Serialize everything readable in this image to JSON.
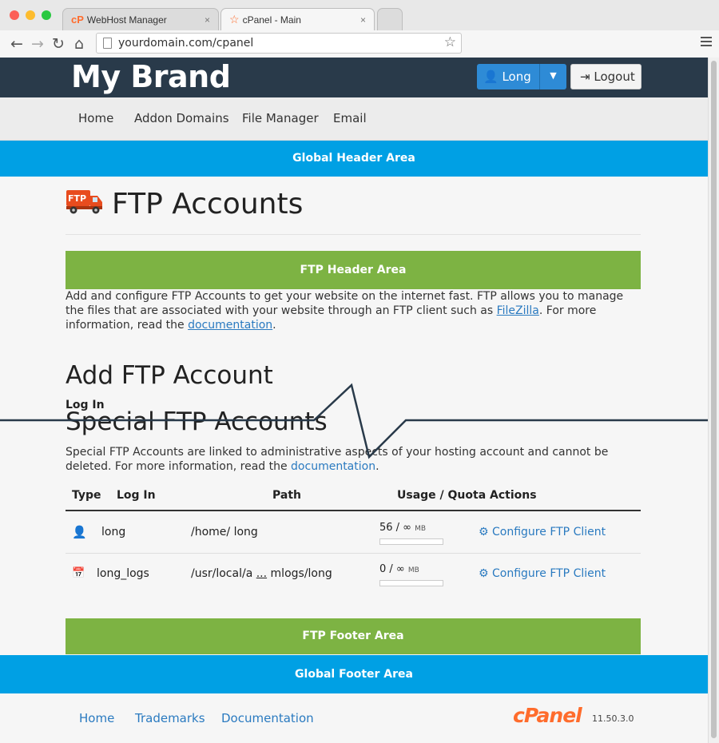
{
  "browser": {
    "tabs": [
      {
        "label": "WebHost Manager",
        "close": "×"
      },
      {
        "label": "cPanel - Main",
        "close": "×"
      }
    ],
    "url": "yourdomain.com/cpanel"
  },
  "header": {
    "brand": "My Brand",
    "user_label": "Long",
    "logout_label": "Logout"
  },
  "nav": [
    "Home",
    "Addon Domains",
    "File Manager",
    "Email"
  ],
  "global_header": "Global Header Area",
  "page_title": "FTP Accounts",
  "ftp_icon_text": "FTP",
  "ftp_header": "FTP Header Area",
  "intro": {
    "text1": "Add and configure FTP Accounts to get your website on the internet fast. FTP allows you to manage the files that are associated with your website through an FTP client such as ",
    "link1": "FileZilla",
    "text2": ". For more information, read the ",
    "link2": "documentation",
    "text3": "."
  },
  "add_title": "Add FTP Account",
  "login_label": "Log In",
  "special_title": "Special FTP Accounts",
  "special_desc": {
    "text1": "Special FTP Accounts are linked to administrative aspects of your hosting account and cannot be deleted. For more information, read the ",
    "link": "documentation",
    "text2": "."
  },
  "table": {
    "headers": {
      "type": "Type",
      "login": "Log In",
      "path": "Path",
      "usage": "Usage / Quota",
      "actions": "Actions"
    },
    "rows": [
      {
        "login": "long",
        "path": "/home/ long",
        "usage": "56 / ∞",
        "unit": "MB",
        "usage_fraction": 0,
        "action": "Configure FTP Client"
      },
      {
        "login": "long_logs",
        "path_a": "/usr/local/a",
        "path_ellipsis": "...",
        "path_b": "mlogs/long",
        "usage": "0 / ∞",
        "unit": "MB",
        "usage_fraction": 0,
        "action": "Configure FTP Client"
      }
    ]
  },
  "ftp_footer": "FTP Footer Area",
  "global_footer": "Global Footer Area",
  "footer": {
    "links": [
      "Home",
      "Trademarks",
      "Documentation"
    ],
    "logo": "cPanel",
    "version": "11.50.3.0"
  },
  "colors": {
    "brand_bar": "#293a4a",
    "global_area": "#00a0e4",
    "ftp_area": "#7db343",
    "primary_button": "#2e8bd6",
    "link": "#2a7ac0",
    "cpanel_orange": "#ff6c2c"
  },
  "icons": [
    "back-arrow-icon",
    "forward-arrow-icon",
    "reload-icon",
    "home-icon",
    "bookmark-star-icon",
    "menu-icon",
    "user-icon",
    "logout-icon",
    "ftp-truck-icon",
    "user-account-icon",
    "calendar-log-icon",
    "gear-icon"
  ]
}
